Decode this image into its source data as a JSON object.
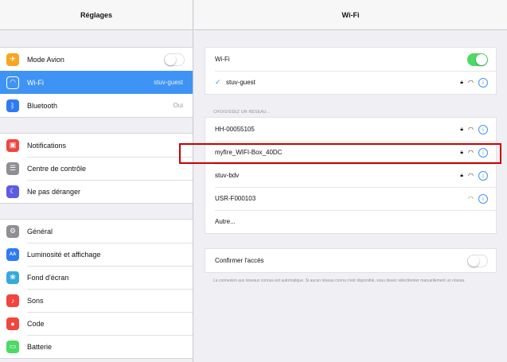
{
  "left": {
    "title": "Réglages",
    "group1": [
      {
        "label": "Mode Avion",
        "icon": "airplane-icon",
        "icon_color": "#f6a623",
        "toggle": "off"
      },
      {
        "label": "Wi-Fi",
        "icon": "wifi-icon",
        "icon_color": "#3f93f5",
        "value": "stuv-guest",
        "selected": true
      },
      {
        "label": "Bluetooth",
        "icon": "bluetooth-icon",
        "icon_color": "#2f7bf5",
        "value": "Oui"
      }
    ],
    "group2": [
      {
        "label": "Notifications",
        "icon": "notifications-icon",
        "icon_color": "#f2453d"
      },
      {
        "label": "Centre de contrôle",
        "icon": "control-center-icon",
        "icon_color": "#8e8e93"
      },
      {
        "label": "Ne pas déranger",
        "icon": "moon-icon",
        "icon_color": "#5b5ce2"
      }
    ],
    "group3": [
      {
        "label": "Général",
        "icon": "gear-icon",
        "icon_color": "#8e8e93"
      },
      {
        "label": "Luminosité et affichage",
        "icon": "brightness-icon",
        "icon_color": "#2f7bf5"
      },
      {
        "label": "Fond d'écran",
        "icon": "wallpaper-icon",
        "icon_color": "#35aadc"
      },
      {
        "label": "Sons",
        "icon": "sound-icon",
        "icon_color": "#f2453d"
      },
      {
        "label": "Code",
        "icon": "lock-icon",
        "icon_color": "#f2453d"
      },
      {
        "label": "Batterie",
        "icon": "battery-icon",
        "icon_color": "#4cd964"
      }
    ]
  },
  "right": {
    "title": "Wi-Fi",
    "wifi_label": "Wi-Fi",
    "wifi_toggle": "on",
    "connected": "stuv-guest",
    "section_title": "CHOISISSEZ UN RÉSEAU...",
    "networks": [
      {
        "name": "HH-00055105",
        "locked": true,
        "wifi_color": "#111111"
      },
      {
        "name": "myfire_WIFI-Box_40DC",
        "locked": true,
        "wifi_color": "#111111"
      },
      {
        "name": "stuv-bdv",
        "locked": true,
        "wifi_color": "#111111"
      },
      {
        "name": "USR-F000103",
        "locked": false,
        "wifi_color": "#8a8a00"
      }
    ],
    "other_label": "Autre...",
    "ask_join_label": "Confirmer l'accès",
    "ask_join_toggle": "off",
    "ask_join_desc": "La connexion aux réseaux connus est automatique. Si aucun réseau connu n'est disponible, vous devez sélectionner manuellement un réseau."
  },
  "colors": {
    "accent": "#3f93f5",
    "highlight": "#c80000",
    "toggle_on": "#4cd964"
  }
}
